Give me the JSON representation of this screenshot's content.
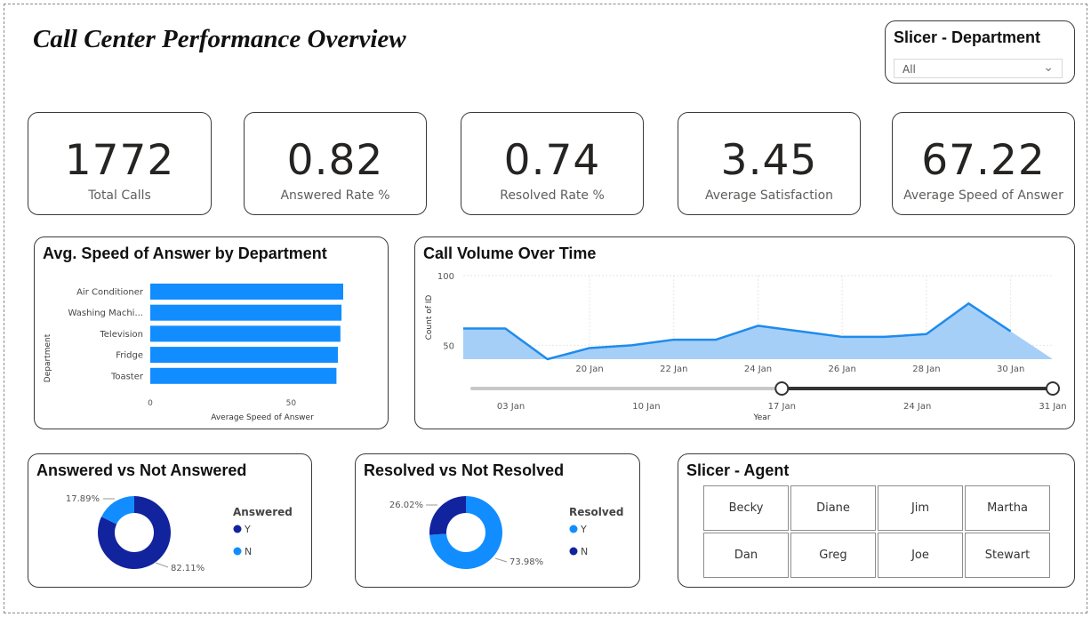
{
  "title": "Call Center Performance Overview",
  "slicer_department": {
    "label": "Slicer - Department",
    "value": "All"
  },
  "kpis": [
    {
      "value": "1772",
      "label": "Total Calls"
    },
    {
      "value": "0.82",
      "label": "Answered Rate %"
    },
    {
      "value": "0.74",
      "label": "Resolved Rate %"
    },
    {
      "value": "3.45",
      "label": "Average Satisfaction"
    },
    {
      "value": "67.22",
      "label": "Average Speed of Answer"
    }
  ],
  "slicer_agent": {
    "label": "Slicer - Agent",
    "agents": [
      "Becky",
      "Diane",
      "Jim",
      "Martha",
      "Dan",
      "Greg",
      "Joe",
      "Stewart"
    ]
  },
  "colors": {
    "bar": "#118dff",
    "line": "#1f8bec",
    "area": "#a6cff7",
    "dark_blue": "#12239e",
    "light_blue": "#118dff"
  },
  "chart_data": [
    {
      "type": "bar",
      "orientation": "horizontal",
      "title": "Avg. Speed of Answer by Department",
      "categories": [
        "Air Conditioner",
        "Washing Machi...",
        "Television",
        "Fridge",
        "Toaster"
      ],
      "values": [
        68.5,
        67.9,
        67.5,
        66.6,
        66.1
      ],
      "xlabel": "Average Speed of Answer",
      "ylabel": "Department",
      "xlim": [
        0,
        68.5
      ],
      "xticks": [
        "0",
        "50"
      ],
      "xtick_values": [
        0,
        50
      ]
    },
    {
      "type": "area",
      "title": "Call Volume Over Time",
      "ylabel": "Count of ID",
      "yticks": [
        "100",
        "50"
      ],
      "ytick_values": [
        100,
        50
      ],
      "xticks": [
        "20 Jan",
        "22 Jan",
        "24 Jan",
        "26 Jan",
        "28 Jan",
        "30 Jan"
      ],
      "xtick_values": [
        20,
        22,
        24,
        26,
        28,
        30
      ],
      "x": [
        17,
        18,
        19,
        20,
        21,
        22,
        23,
        24,
        25,
        26,
        27,
        28,
        29,
        30,
        31
      ],
      "values": [
        62,
        62,
        40,
        48,
        50,
        54,
        54,
        64,
        60,
        56,
        56,
        58,
        80,
        60
      ],
      "x_days": [
        17,
        18,
        19,
        20,
        21,
        22,
        23,
        24,
        25,
        26,
        27,
        28,
        29,
        30,
        31
      ],
      "ylim": [
        40,
        100
      ],
      "slider": {
        "label": "Year",
        "ticks": [
          "03 Jan",
          "10 Jan",
          "17 Jan",
          "24 Jan",
          "31 Jan"
        ],
        "tick_days": [
          3,
          10,
          17,
          24,
          31
        ],
        "range": [
          1,
          31
        ],
        "selected": [
          17,
          31
        ]
      }
    },
    {
      "type": "pie",
      "title": "Answered vs Not Answered",
      "legend_title": "Answered",
      "labels": [
        "Y",
        "N"
      ],
      "values": [
        82.11,
        17.89
      ],
      "data_labels": [
        "82.11%",
        "17.89%"
      ],
      "colors": [
        "#12239e",
        "#118dff"
      ]
    },
    {
      "type": "pie",
      "title": "Resolved vs Not Resolved",
      "legend_title": "Resolved",
      "labels": [
        "Y",
        "N"
      ],
      "values": [
        73.98,
        26.02
      ],
      "data_labels": [
        "73.98%",
        "26.02%"
      ],
      "colors": [
        "#118dff",
        "#12239e"
      ]
    }
  ]
}
